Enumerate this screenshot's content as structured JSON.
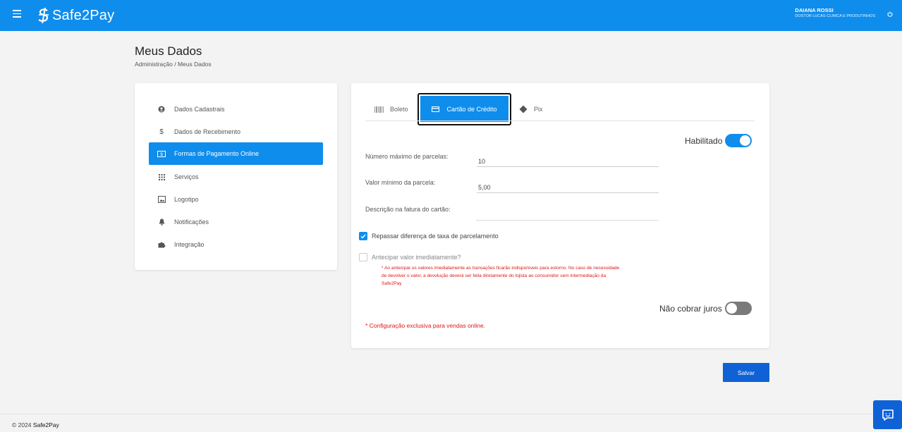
{
  "header": {
    "logo_text": "Safe2Pay",
    "user_name": "DAIANA ROSSI",
    "user_company": "DOSTOR LUCAS CLINICA E PRODUTINHOS"
  },
  "page": {
    "title": "Meus Dados",
    "breadcrumb": "Administração  /  Meus Dados"
  },
  "sidebar": {
    "items": [
      {
        "label": "Dados Cadastrais",
        "icon": "user-circle-icon"
      },
      {
        "label": "Dados de Recebimento",
        "icon": "dollar-icon"
      },
      {
        "label": "Formas de Pagamento Online",
        "icon": "money-icon",
        "active": true
      },
      {
        "label": "Serviços",
        "icon": "grid-icon"
      },
      {
        "label": "Logotipo",
        "icon": "image-icon"
      },
      {
        "label": "Notificações",
        "icon": "bell-icon"
      },
      {
        "label": "Integração",
        "icon": "puzzle-icon"
      }
    ]
  },
  "tabs": {
    "boleto": "Boleto",
    "cartao": "Cartão de Crédito",
    "pix": "Pix"
  },
  "form": {
    "habilitado_label": "Habilitado",
    "max_parcelas_label": "Número máximo de parcelas:",
    "max_parcelas_value": "10",
    "valor_minimo_label": "Valor mínimo da parcela:",
    "valor_minimo_value": "5,00",
    "descricao_label": "Descrição na fatura do cartão:",
    "descricao_value": "",
    "repassar_label": "Repassar diferença de taxa de parcelamento",
    "antecipar_label": "Antecipar valor imediatamente?",
    "antecipar_warning": "* Ao antecipar os valores imediatamente as transações ficarão indisponíveis para estorno. No caso de necessidade de devolver o valor, a devolução deverá ser feita diretamente do lojista ao consumidor sem intermediação da Safe2Pay",
    "nao_cobrar_label": "Não cobrar juros",
    "online_note": "* Configuração exclusiva para vendas online.",
    "save_label": "Salvar"
  },
  "footer": {
    "copyright": "© 2024",
    "brand": "Safe2Pay"
  },
  "colors": {
    "primary": "#0f8ded",
    "button": "#0f62d6",
    "warning": "#e01414"
  }
}
